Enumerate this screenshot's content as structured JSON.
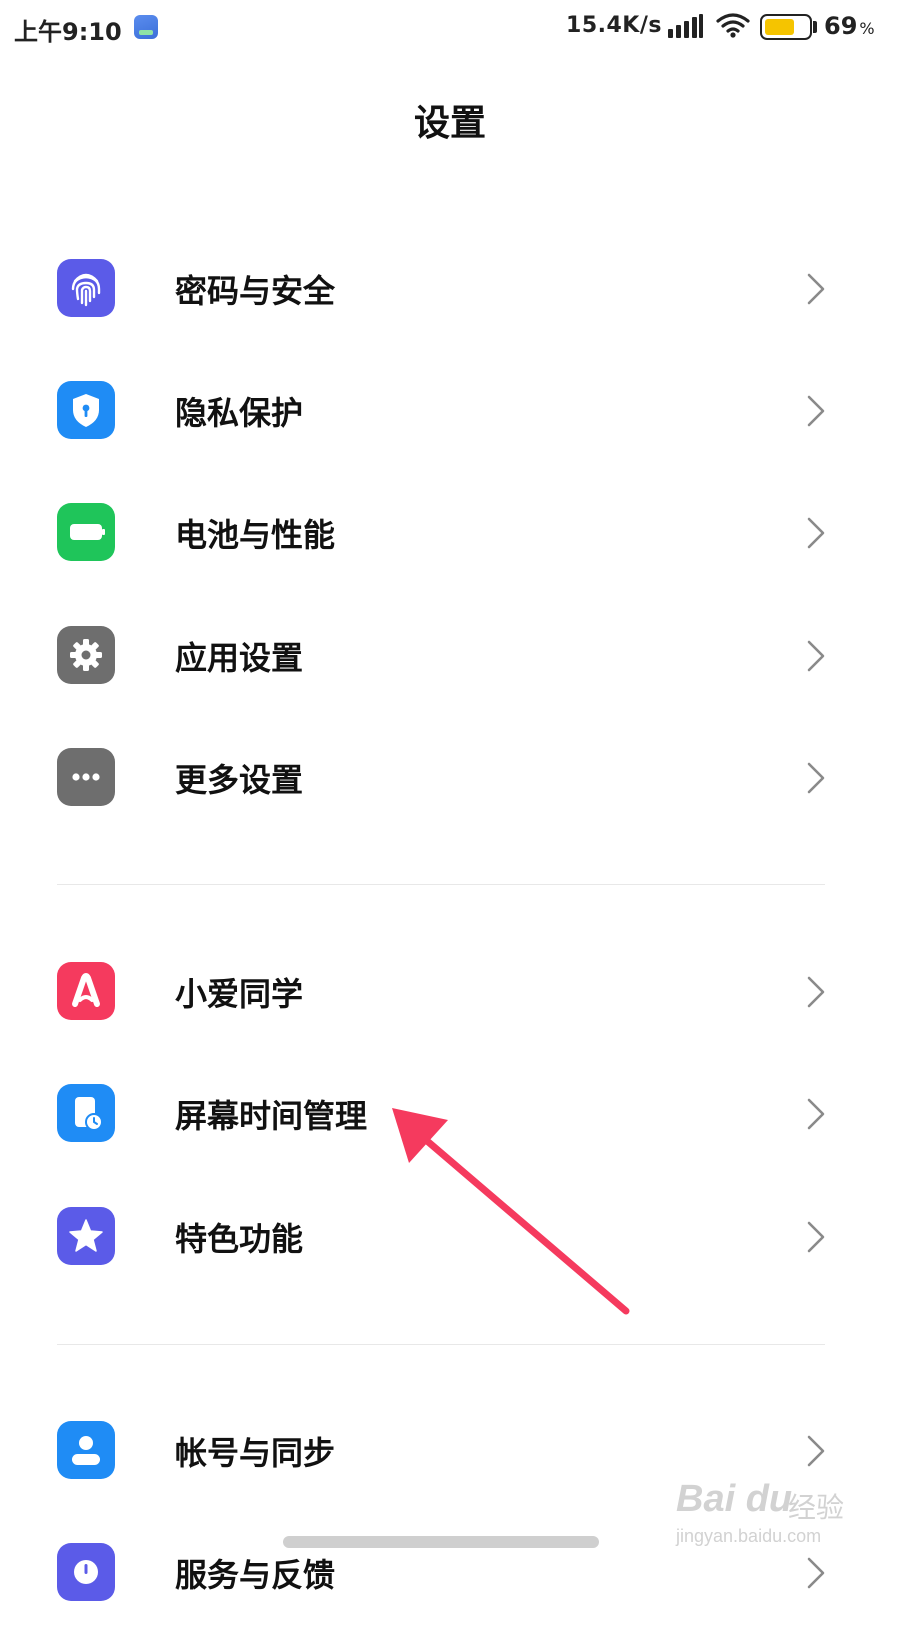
{
  "status_bar": {
    "time": "上午9:10",
    "network_speed": "15.4K/s",
    "battery_percent": "69",
    "battery_percent_sign": "%",
    "battery_level": 0.69,
    "battery_color": "#f5c400",
    "icons": [
      "app-notification-icon",
      "signal-icon",
      "wifi-icon",
      "battery-icon"
    ]
  },
  "header": {
    "title": "设置"
  },
  "groups": [
    {
      "items": [
        {
          "label": "密码与安全",
          "icon": "fingerprint-icon",
          "icon_color": "#5b5be8"
        },
        {
          "label": "隐私保护",
          "icon": "shield-lock-icon",
          "icon_color": "#1f8cf5"
        },
        {
          "label": "电池与性能",
          "icon": "battery-icon",
          "icon_color": "#1fc55a"
        },
        {
          "label": "应用设置",
          "icon": "gear-icon",
          "icon_color": "#6e6e6e"
        },
        {
          "label": "更多设置",
          "icon": "more-dots-icon",
          "icon_color": "#6e6e6e"
        }
      ]
    },
    {
      "items": [
        {
          "label": "小爱同学",
          "icon": "xiaoai-icon",
          "icon_color": "#f53a5e"
        },
        {
          "label": "屏幕时间管理",
          "icon": "screen-time-icon",
          "icon_color": "#1f8cf5"
        },
        {
          "label": "特色功能",
          "icon": "star-icon",
          "icon_color": "#5b5be8"
        }
      ]
    },
    {
      "items": [
        {
          "label": "帐号与同步",
          "icon": "account-icon",
          "icon_color": "#1f8cf5"
        },
        {
          "label": "服务与反馈",
          "icon": "service-feedback-icon",
          "icon_color": "#5b5be8"
        }
      ]
    }
  ],
  "annotation": {
    "color": "#f53a5e",
    "points_to": "屏幕时间管理"
  },
  "watermark": {
    "logo": "Bai du",
    "cn": "经验",
    "url": "jingyan.baidu.com"
  }
}
